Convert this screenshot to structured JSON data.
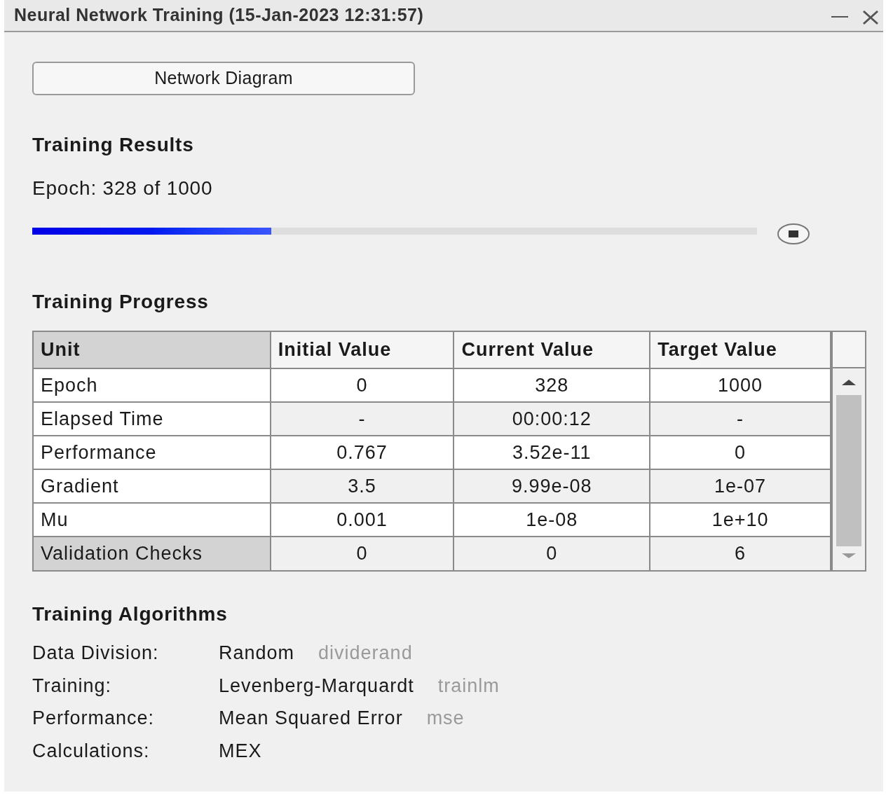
{
  "window": {
    "title": "Neural Network Training (15-Jan-2023 12:31:57)"
  },
  "diagram_button": "Network Diagram",
  "training_results": {
    "heading": "Training Results",
    "epoch_text": "Epoch: 328 of 1000",
    "progress": {
      "level": 0.33
    }
  },
  "training_progress": {
    "heading": "Training Progress",
    "columns": [
      "Unit",
      "Initial Value",
      "Current Value",
      "Target Value"
    ],
    "rows": [
      {
        "cells": [
          "Epoch",
          "0",
          "328",
          "1000"
        ],
        "selected": false
      },
      {
        "cells": [
          "Elapsed Time",
          "-",
          "00:00:12",
          "-"
        ],
        "selected": false
      },
      {
        "cells": [
          "Performance",
          "0.767",
          "3.52e-11",
          "0"
        ],
        "selected": false
      },
      {
        "cells": [
          "Gradient",
          "3.5",
          "9.99e-08",
          "1e-07"
        ],
        "selected": false
      },
      {
        "cells": [
          "Mu",
          "0.001",
          "1e-08",
          "1e+10"
        ],
        "selected": false
      },
      {
        "cells": [
          "Validation Checks",
          "0",
          "0",
          "6"
        ],
        "selected": true
      }
    ]
  },
  "training_algorithms": {
    "heading": "Training Algorithms",
    "rows": [
      {
        "label": "Data Division:",
        "value": "Random",
        "function": "dividerand"
      },
      {
        "label": "Training:",
        "value": "Levenberg-Marquardt",
        "function": "trainlm"
      },
      {
        "label": "Performance:",
        "value": "Mean Squared Error",
        "function": "mse"
      },
      {
        "label": "Calculations:",
        "value": "MEX"
      }
    ]
  }
}
